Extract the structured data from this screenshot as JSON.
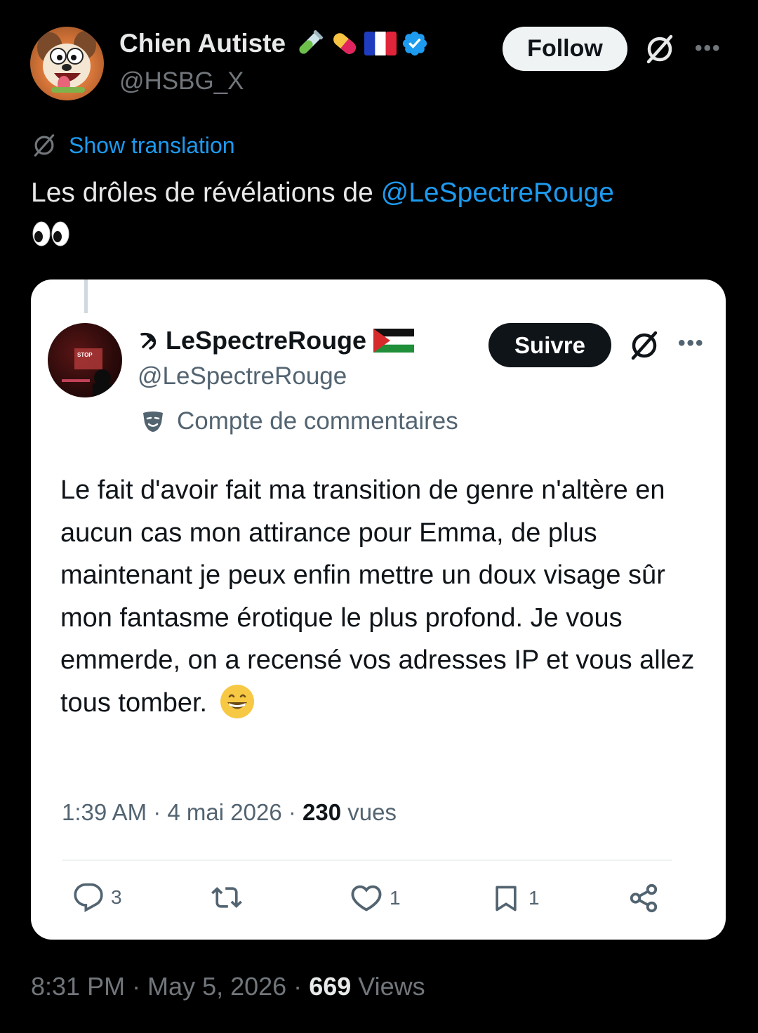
{
  "tweet": {
    "author": {
      "name": "Chien Autiste",
      "handle": "@HSBG_X",
      "badges": [
        "test-tube-emoji",
        "pill-emoji",
        "france-flag-emoji",
        "verified-badge"
      ]
    },
    "follow_label": "Follow",
    "translation_label": "Show translation",
    "text_prefix": "Les drôles de révélations de ",
    "mention": "@LeSpectreRouge",
    "emoji": "👀",
    "timestamp": "8:31 PM · May 5, 2026 · ",
    "views_count": "669",
    "views_label": "Views"
  },
  "quoted": {
    "author": {
      "name": "LeSpectreRouge",
      "handle": "@LeSpectreRouge",
      "prefix_icon": "hammer-sickle",
      "badge": "palestine-flag-emoji"
    },
    "follow_label": "Suivre",
    "parody_label": "Compte de commentaires",
    "text": "Le fait d'avoir fait ma transition de genre n'altère en aucun cas mon attirance pour Emma, de plus maintenant je peux enfin mettre un doux visage sûr mon fantasme érotique le plus profond. Je vous emmerde, on a recensé vos adresses IP et vous allez tous tomber.",
    "timestamp": "1:39 AM · 4 mai 2026 · ",
    "views_count": "230",
    "views_label": "vues",
    "actions": {
      "replies": "3",
      "likes": "1",
      "bookmarks": "1"
    }
  },
  "colors": {
    "background": "#000000",
    "accent": "#1d9bf0",
    "card": "#ffffff"
  }
}
